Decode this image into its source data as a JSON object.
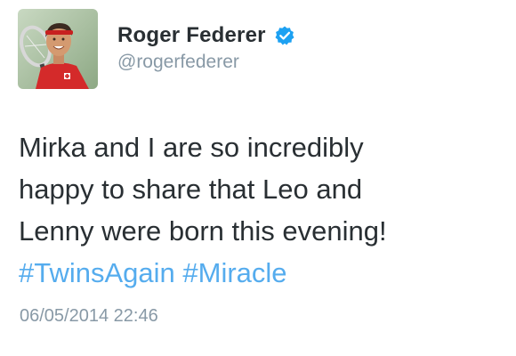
{
  "author": {
    "display_name": "Roger Federer",
    "handle": "@rogerfederer",
    "verified": true,
    "avatar_icon": "profile-photo-tennis-player",
    "verified_icon": "verified-badge-icon"
  },
  "tweet": {
    "lines": [
      "Mirka and I are so incredibly",
      "happy to share that Leo and",
      "Lenny were born this evening!"
    ],
    "hashtags": [
      "#TwinsAgain",
      "#Miracle"
    ],
    "timestamp": "06/05/2014 22:46"
  },
  "colors": {
    "text": "#292f33",
    "secondary": "#8899a6",
    "link": "#55acee",
    "verified": "#1da1f2",
    "background": "#ffffff"
  }
}
